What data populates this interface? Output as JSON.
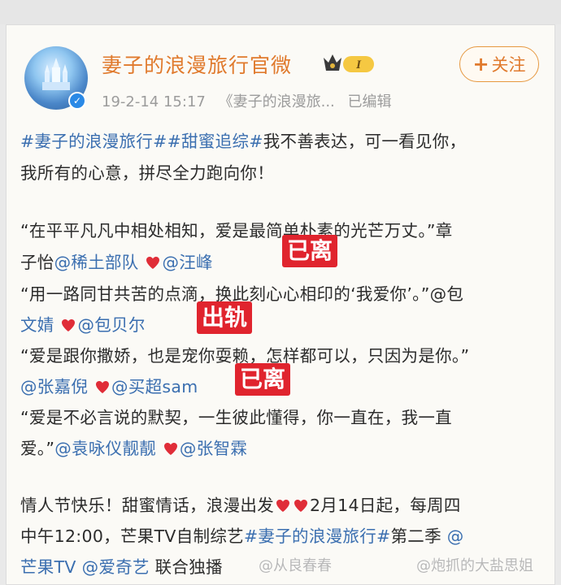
{
  "account": {
    "name": "妻子的浪漫旅行官微",
    "timestamp": "19-2-14 15:17",
    "source": "《妻子的浪漫旅...",
    "edited": "已编辑",
    "follow_label": "关注",
    "follow_plus": "+",
    "badge_level": "I"
  },
  "post": {
    "line1_tag1": "#妻子的浪漫旅行#",
    "line1_tag2": "#甜蜜追综#",
    "line1_text": "我不善表达，可一看见你，",
    "line2_text": "我所有的心意，拼尽全力跑向你！",
    "q1_line1": "“在平平凡凡中相处相知，爱是最简单朴素的光芒万丈。”章",
    "q1_l2_pre": "子怡",
    "q1_l2_m1": "@稀土部队",
    "q1_l2_m2": "@汪峰",
    "q2_line1": "“用一路同甘共苦的点滴，换此刻心心相印的‘我爱你’。”@包",
    "q2_l2_m1": "文婧",
    "q2_l2_m2": "@包贝尔",
    "q3_line1": "“爱是跟你撒娇，也是宠你耍赖，怎样都可以，只因为是你。”",
    "q3_l2_m1": "@张嘉倪",
    "q3_l2_m2": "@买超sam",
    "q4_line1": "“爱是不必言说的默契，一生彼此懂得，你一直在，我一直",
    "q4_l2_pre": "爱。”",
    "q4_l2_m1": "@袁咏仪靓靓",
    "q4_l2_m2": "@张智霖",
    "e_line1_pre": "情人节快乐！甜蜜情话，浪漫出发",
    "e_line1_post": "2月14日起，每周四",
    "e_line2_pre": "中午12:00，芒果TV自制综艺",
    "e_line2_tag": "#妻子的浪漫旅行#",
    "e_line2_post": "第二季",
    "e_line2_mention": "@",
    "e_line3_m1": "芒果TV",
    "e_line3_m2": "@爱奇艺",
    "e_line3_post": "联合独播"
  },
  "overlays": {
    "label1": "已离",
    "label2": "出轨",
    "label3": "已离"
  },
  "watermarks": {
    "wm1": "@从良春春",
    "wm2": "@炮抓的大盐思姐"
  },
  "colors": {
    "name": "#e07a2d",
    "link": "#3b6fb0",
    "label_bg": "#e0242e",
    "heart": "#e02d38"
  }
}
